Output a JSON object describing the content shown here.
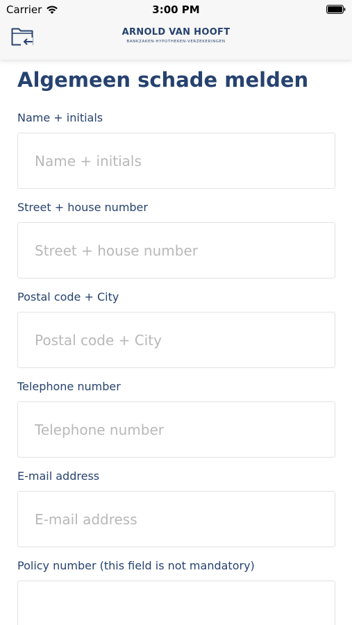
{
  "status_bar": {
    "carrier": "Carrier",
    "time": "3:00 PM"
  },
  "navbar": {
    "logo_name": "ARNOLD VAN HOOFT",
    "logo_tagline": "BANKZAKEN-HYPOTHEKEN-VERZEKERINGEN"
  },
  "page": {
    "title": "Algemeen schade melden"
  },
  "form": {
    "fields": [
      {
        "label": "Name + initials",
        "placeholder": "Name + initials",
        "value": ""
      },
      {
        "label": "Street + house number",
        "placeholder": "Street + house number",
        "value": ""
      },
      {
        "label": "Postal code + City",
        "placeholder": "Postal code + City",
        "value": ""
      },
      {
        "label": "Telephone number",
        "placeholder": "Telephone number",
        "value": ""
      },
      {
        "label": "E-mail address",
        "placeholder": "E-mail address",
        "value": ""
      },
      {
        "label": "Policy number (this field is not mandatory)",
        "placeholder": "",
        "value": ""
      }
    ]
  },
  "colors": {
    "brand": "#26426f",
    "placeholder": "#b8b8b8",
    "border": "#e2e2e2",
    "topbar": "#f7f7f7"
  },
  "icons": {
    "back": "folder-back-icon",
    "wifi": "wifi-icon",
    "battery": "battery-icon"
  }
}
